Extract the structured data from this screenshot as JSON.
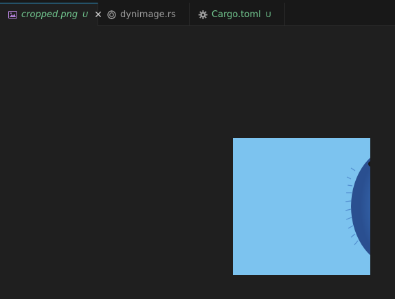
{
  "tabs": [
    {
      "label": "cropped.png",
      "modified": "U",
      "icon": "image-file-icon",
      "active": true,
      "italic": true,
      "color": "#73c991"
    },
    {
      "label": "dynimage.rs",
      "modified": "",
      "icon": "rust-file-icon",
      "active": false,
      "italic": false,
      "color": "#9d9d9d"
    },
    {
      "label": "Cargo.toml",
      "modified": "U",
      "icon": "gear-icon",
      "active": false,
      "italic": false,
      "color": "#73c991"
    }
  ],
  "close_glyph": "✕",
  "preview": {
    "subject": "blue furry creature partially visible",
    "background_color": "#7cc3ef",
    "fur_color": "#3a6fb8"
  },
  "colors": {
    "editor_bg": "#1f1f1f",
    "tabbar_bg": "#181818",
    "accent": "#2fa0d6",
    "git_untracked": "#73c991"
  }
}
